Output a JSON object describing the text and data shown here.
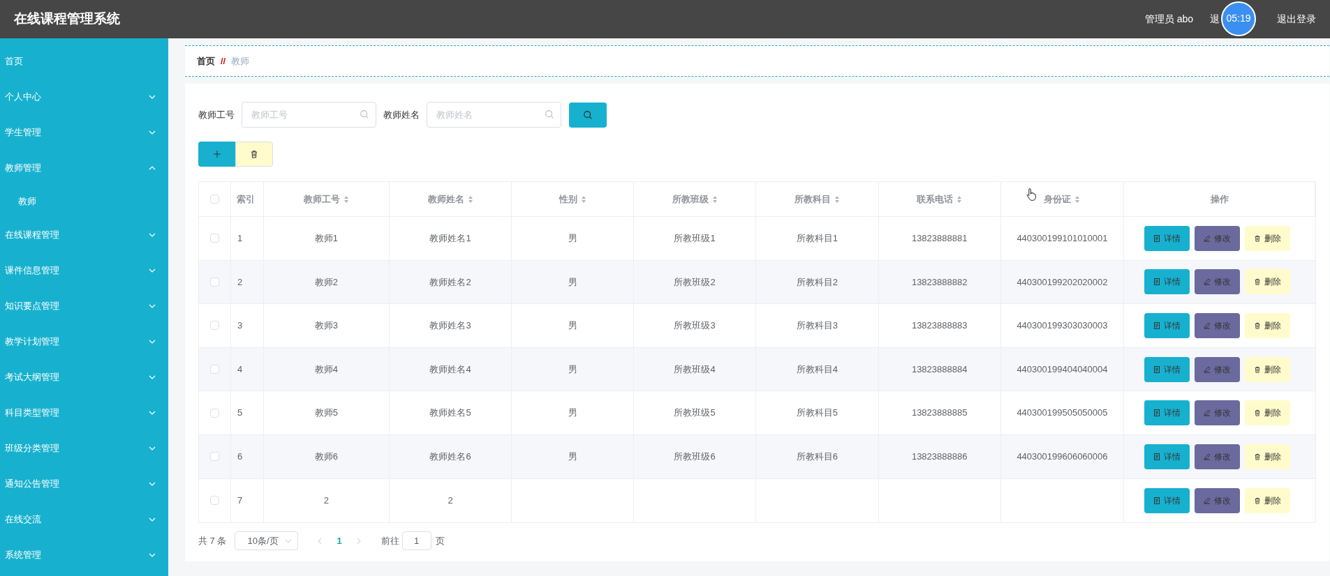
{
  "header": {
    "title": "在线课程管理系统",
    "user": "管理员 abo",
    "covered_link": "退",
    "logout": "退出登录",
    "timer": "05:19"
  },
  "sidebar": {
    "items": [
      {
        "label": "首页",
        "kind": "link"
      },
      {
        "label": "个人中心",
        "kind": "menu",
        "expanded": false
      },
      {
        "label": "学生管理",
        "kind": "menu",
        "expanded": false
      },
      {
        "label": "教师管理",
        "kind": "menu",
        "expanded": true,
        "children": [
          {
            "label": "教师"
          }
        ]
      },
      {
        "label": "在线课程管理",
        "kind": "menu",
        "expanded": false
      },
      {
        "label": "课件信息管理",
        "kind": "menu",
        "expanded": false
      },
      {
        "label": "知识要点管理",
        "kind": "menu",
        "expanded": false
      },
      {
        "label": "教学计划管理",
        "kind": "menu",
        "expanded": false
      },
      {
        "label": "考试大纲管理",
        "kind": "menu",
        "expanded": false
      },
      {
        "label": "科目类型管理",
        "kind": "menu",
        "expanded": false
      },
      {
        "label": "班级分类管理",
        "kind": "menu",
        "expanded": false
      },
      {
        "label": "通知公告管理",
        "kind": "menu",
        "expanded": false
      },
      {
        "label": "在线交流",
        "kind": "menu",
        "expanded": false
      },
      {
        "label": "系统管理",
        "kind": "menu",
        "expanded": false
      }
    ]
  },
  "breadcrumb": {
    "home": "首页",
    "separator": "//",
    "current": "教师"
  },
  "search": {
    "fields": [
      {
        "label": "教师工号",
        "placeholder": "教师工号"
      },
      {
        "label": "教师姓名",
        "placeholder": "教师姓名"
      }
    ]
  },
  "table": {
    "all_checked": false,
    "columns": [
      {
        "label": "索引",
        "sortable": false
      },
      {
        "label": "教师工号",
        "sortable": true
      },
      {
        "label": "教师姓名",
        "sortable": true
      },
      {
        "label": "性别",
        "sortable": true
      },
      {
        "label": "所教班级",
        "sortable": true
      },
      {
        "label": "所教科目",
        "sortable": true
      },
      {
        "label": "联系电话",
        "sortable": true
      },
      {
        "label": "身份证",
        "sortable": true
      },
      {
        "label": "操作",
        "sortable": false
      }
    ],
    "rows": [
      {
        "checked": false,
        "cells": [
          "1",
          "教师1",
          "教师姓名1",
          "男",
          "所教班级1",
          "所教科目1",
          "13823888881",
          "440300199101010001"
        ],
        "actions": [
          "详情",
          "修改",
          "删除"
        ]
      },
      {
        "checked": false,
        "cells": [
          "2",
          "教师2",
          "教师姓名2",
          "男",
          "所教班级2",
          "所教科目2",
          "13823888882",
          "440300199202020002"
        ],
        "actions": [
          "详情",
          "修改",
          "删除"
        ]
      },
      {
        "checked": false,
        "cells": [
          "3",
          "教师3",
          "教师姓名3",
          "男",
          "所教班级3",
          "所教科目3",
          "13823888883",
          "440300199303030003"
        ],
        "actions": [
          "详情",
          "修改",
          "删除"
        ]
      },
      {
        "checked": false,
        "cells": [
          "4",
          "教师4",
          "教师姓名4",
          "男",
          "所教班级4",
          "所教科目4",
          "13823888884",
          "440300199404040004"
        ],
        "actions": [
          "详情",
          "修改",
          "删除"
        ]
      },
      {
        "checked": false,
        "cells": [
          "5",
          "教师5",
          "教师姓名5",
          "男",
          "所教班级5",
          "所教科目5",
          "13823888885",
          "440300199505050005"
        ],
        "actions": [
          "详情",
          "修改",
          "删除"
        ]
      },
      {
        "checked": false,
        "cells": [
          "6",
          "教师6",
          "教师姓名6",
          "男",
          "所教班级6",
          "所教科目6",
          "13823888886",
          "440300199606060006"
        ],
        "actions": [
          "详情",
          "修改",
          "删除"
        ]
      },
      {
        "checked": false,
        "cells": [
          "7",
          "2",
          "2",
          "",
          "",
          "",
          "",
          ""
        ],
        "actions": [
          "详情",
          "修改",
          "删除"
        ]
      }
    ]
  },
  "pagination": {
    "total": "共 7 条",
    "page_size": "10条/页",
    "pages": [
      {
        "label": "1",
        "selected": true
      }
    ],
    "goto_label": "前往",
    "goto_value": "1",
    "goto_suffix": "页"
  }
}
